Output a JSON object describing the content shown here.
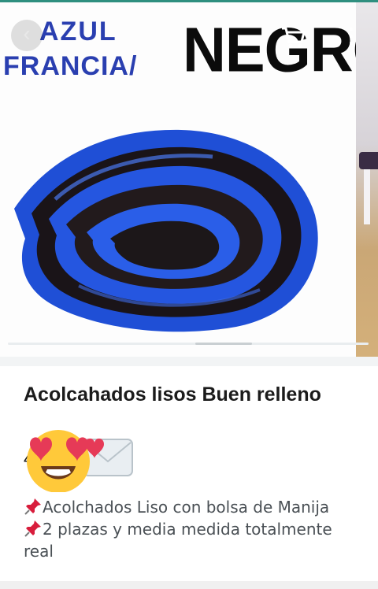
{
  "gallery": {
    "image_text_line1": "AZUL",
    "image_text_line2": "FRANCIA/",
    "image_text_big": "NEGRO",
    "back_label": "‹",
    "menu_label": "⋮"
  },
  "product": {
    "title": "Acolcahados lisos Buen relleno",
    "price_fragment": "4"
  },
  "description": {
    "line1": "Acolchados Liso con bolsa de Manija",
    "line2": "2 plazas y media medida totalmente real"
  },
  "icons": {
    "back": "arrow-back-icon",
    "cart": "shopping-cart-icon",
    "menu": "more-vert-icon",
    "pin": "pushpin-icon",
    "sticker": "heart-eyes-emoji-icon"
  },
  "colors": {
    "accent_blue": "#2a3fb0",
    "status_strip": "#2f8f7f",
    "text_dark": "#1b1b1b",
    "text_muted": "#4a5055"
  }
}
